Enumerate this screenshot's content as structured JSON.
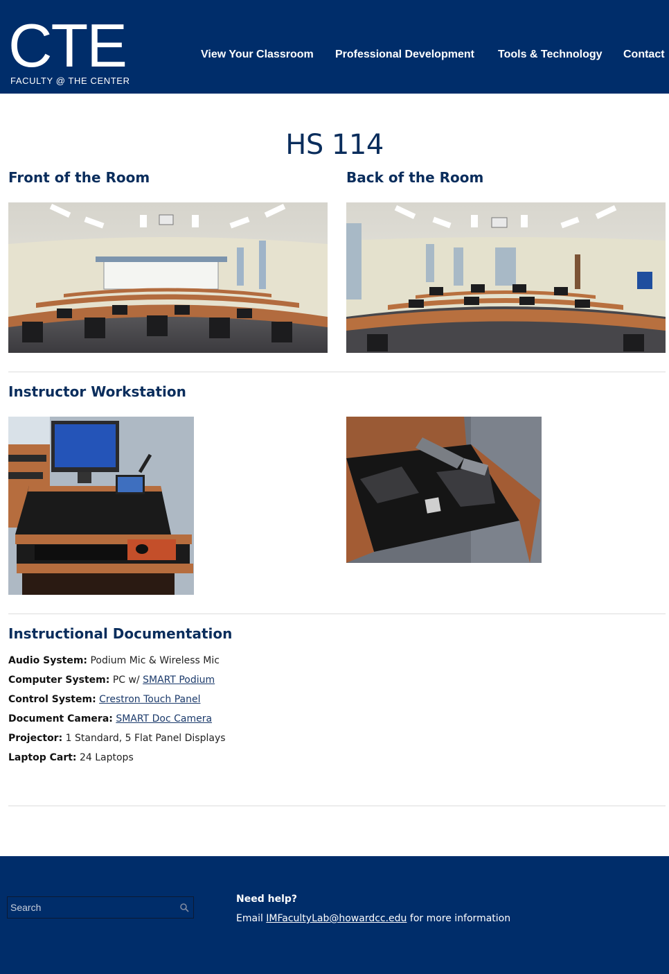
{
  "header": {
    "logo_text": "CTE",
    "logo_subtitle": "FACULTY @ THE CENTER",
    "nav": [
      {
        "label": "View Your Classroom"
      },
      {
        "label": "Professional Development"
      },
      {
        "label": "Tools & Technology"
      },
      {
        "label": "Contact"
      }
    ]
  },
  "page_title": "HS 114",
  "sections": {
    "front": "Front of the Room",
    "back": "Back of the Room",
    "workstation": "Instructor Workstation",
    "documentation": "Instructional Documentation"
  },
  "documentation": [
    {
      "label": "Audio System:",
      "value": "Podium Mic & Wireless Mic",
      "link": ""
    },
    {
      "label": "Computer System:",
      "value": "PC w/ ",
      "link": "SMART Podium"
    },
    {
      "label": "Control System:",
      "value": "",
      "link": "Crestron Touch Panel"
    },
    {
      "label": "Document Camera:",
      "value": "",
      "link": "SMART Doc Camera"
    },
    {
      "label": "Projector:",
      "value": "1 Standard, 5 Flat Panel Displays",
      "link": ""
    },
    {
      "label": "Laptop Cart:",
      "value": "24 Laptops",
      "link": ""
    }
  ],
  "footer": {
    "search_placeholder": "Search",
    "help_title": "Need help?",
    "help_prefix": "Email ",
    "help_email": "IMFacultyLab@howardcc.edu",
    "help_suffix": " for more information"
  },
  "colors": {
    "brand_navy": "#002d6a",
    "heading_navy": "#0a2d5c"
  }
}
